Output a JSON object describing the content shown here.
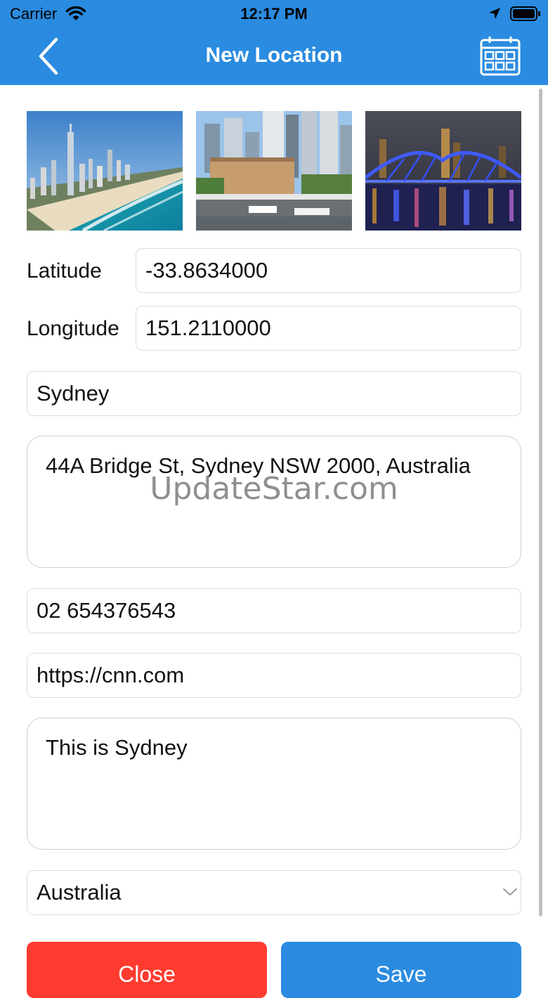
{
  "status_bar": {
    "carrier": "Carrier",
    "time": "12:17 PM"
  },
  "nav": {
    "title": "New Location",
    "back_icon": "chevron-left-icon",
    "calendar_icon": "calendar-icon"
  },
  "photos": [
    {
      "name": "gold-coast-beach-photo"
    },
    {
      "name": "brisbane-river-city-photo"
    },
    {
      "name": "story-bridge-night-photo"
    }
  ],
  "form": {
    "latitude_label": "Latitude",
    "latitude_value": "-33.8634000",
    "longitude_label": "Longitude",
    "longitude_value": "151.2110000",
    "name_value": "Sydney",
    "address_value": "44A Bridge St, Sydney NSW 2000, Australia",
    "phone_value": "02 654376543",
    "website_value": "https://cnn.com",
    "notes_value": "This is Sydney",
    "country_value": "Australia"
  },
  "watermark": "UpdateStar.com",
  "buttons": {
    "close_label": "Close",
    "save_label": "Save"
  },
  "colors": {
    "header": "#2a8be0",
    "close": "#ff3b30",
    "save": "#2a8be0"
  }
}
